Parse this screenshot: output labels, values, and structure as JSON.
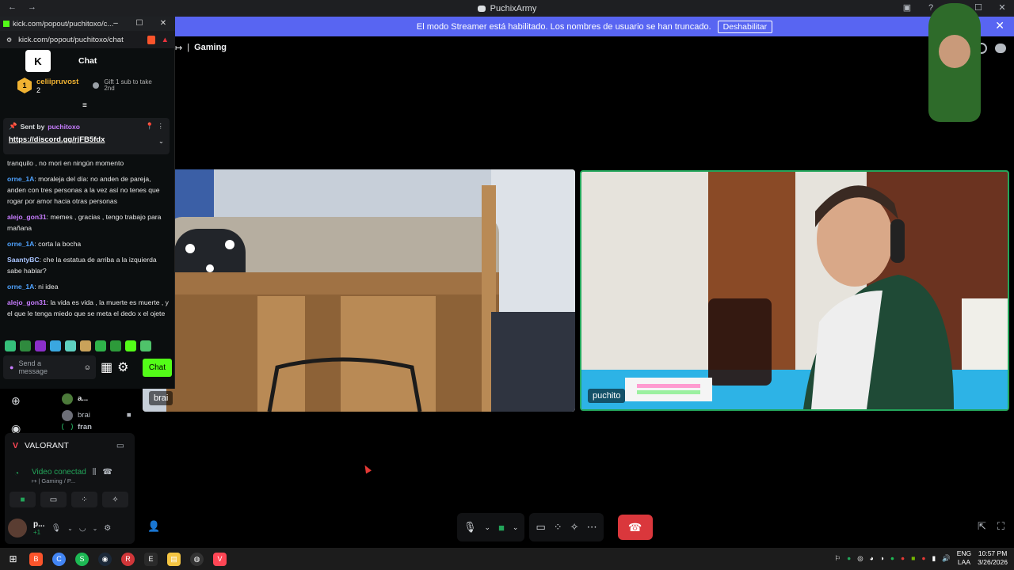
{
  "window": {
    "title": "PuchixArmy",
    "back": "←",
    "forward": "→",
    "minimize": "–",
    "maximize": "☐",
    "close": "✕"
  },
  "banner": {
    "text": "El modo Streamer está habilitado. Los nombres de usuario se han truncado.",
    "disable_label": "Deshabilitar",
    "close": "✕"
  },
  "channel_header": {
    "arrow": "↦",
    "sep": "|",
    "name": "Gaming"
  },
  "popout": {
    "window_title": "kick.com/popout/puchitoxo/c...",
    "url": "kick.com/popout/puchitoxo/chat",
    "minimize": "–",
    "maximize": "☐",
    "close": "✕",
    "logo": "K",
    "chat_title": "Chat",
    "gifter": {
      "rank": "1",
      "name": "celiipruvost",
      "count": "2",
      "cta": "Gift 1 sub to take 2nd"
    },
    "pinned": {
      "sent_by_label": "Sent by",
      "sender": "puchitoxo",
      "link": "https://discord.gg/rjFB5fdx"
    },
    "messages": [
      {
        "user": "",
        "text": "tranquilo , no mori en ningún momento",
        "color": "#e8e8e8"
      },
      {
        "user": "orne_1A",
        "text": ": moraleja del día: no anden de pareja, anden con tres personas a la vez así no tenes que rogar por amor hacia otras personas",
        "color": "#4fa3ff"
      },
      {
        "user": "alejo_gon31",
        "text": ": memes , gracias , tengo trabajo para mañana",
        "color": "#c77dff"
      },
      {
        "user": "orne_1A",
        "text": ": corta la bocha",
        "color": "#4fa3ff"
      },
      {
        "user": "SaantyBC",
        "text": ": che la estatua de arriba a la izquierda sabe hablar?",
        "color": "#a9c4ff"
      },
      {
        "user": "orne_1A",
        "text": ": ni idea",
        "color": "#4fa3ff"
      },
      {
        "user": "alejo_gon31",
        "text": ": la vida es vida , la muerte es muerte , y el que le tenga miedo que se meta el dedo x el ojete",
        "color": "#c77dff"
      }
    ],
    "composer": {
      "placeholder": "Send a message",
      "send_label": "Chat"
    }
  },
  "tiles": [
    {
      "name": "brai"
    },
    {
      "name": "puchito"
    }
  ],
  "voice_list": [
    {
      "name": "a..."
    },
    {
      "name": "brai"
    },
    {
      "name": "fran"
    }
  ],
  "panel": {
    "game": "VALORANT",
    "status": "Video conectad",
    "sub": "↦ | Gaming / P...",
    "user": "p...",
    "user_sub": "+1"
  },
  "taskbar": {
    "lang_top": "ENG",
    "lang_bottom": "LAA",
    "time": "10:57 PM",
    "date": "3/26/2026"
  },
  "colors": {
    "banner": "#5865f2",
    "speaking": "#23a55a",
    "hangup": "#da373c",
    "kick_green": "#53fc18"
  }
}
